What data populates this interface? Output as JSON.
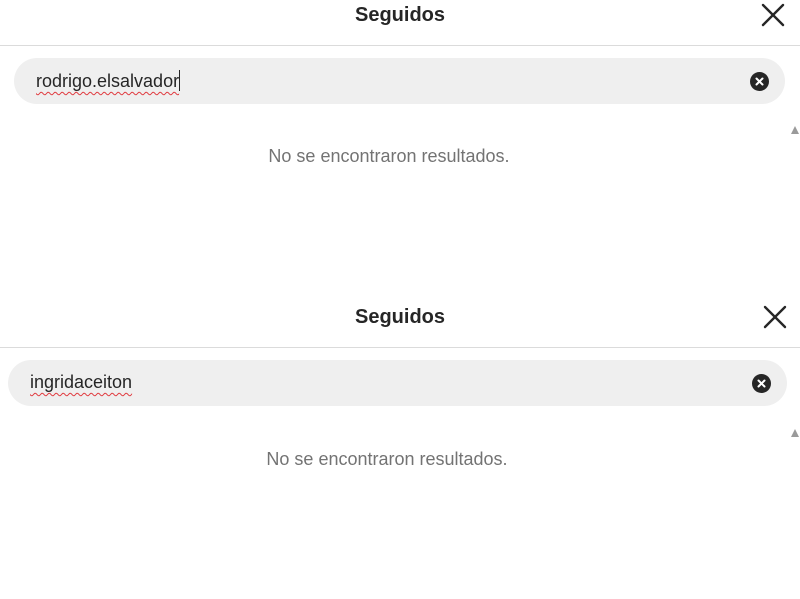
{
  "panels": [
    {
      "title": "Seguidos",
      "search_value": "rodrigo.elsalvador",
      "empty_message": "No se encontraron resultados."
    },
    {
      "title": "Seguidos",
      "search_value": "ingridaceiton",
      "empty_message": "No se encontraron resultados."
    }
  ],
  "icons": {
    "close": "close-icon",
    "clear": "clear-search-icon",
    "scroll_up": "scroll-up-arrow-icon"
  }
}
